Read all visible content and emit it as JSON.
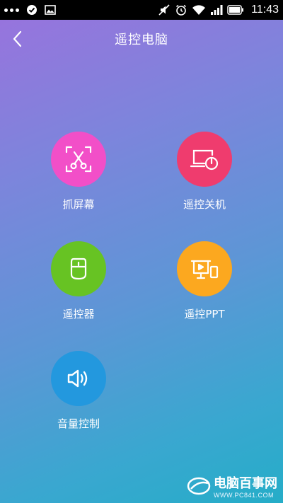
{
  "status_bar": {
    "time": "11:43",
    "icons": [
      "more-dots-icon",
      "check-circle-icon",
      "image-icon",
      "mute-icon",
      "alarm-icon",
      "wifi-icon",
      "signal-icon",
      "battery-icon"
    ]
  },
  "header": {
    "title": "遥控电脑",
    "back_icon": "chevron-left-icon"
  },
  "features": [
    {
      "label": "抓屏幕",
      "color": "#f24fc8",
      "icon": "screenshot-scissors-icon"
    },
    {
      "label": "遥控关机",
      "color": "#ef3c6e",
      "icon": "laptop-power-icon"
    },
    {
      "label": "遥控器",
      "color": "#67c323",
      "icon": "mouse-icon"
    },
    {
      "label": "遥控PPT",
      "color": "#fca81f",
      "icon": "presentation-icon"
    },
    {
      "label": "音量控制",
      "color": "#2398de",
      "icon": "speaker-icon"
    }
  ],
  "watermark": {
    "text": "电脑百事网",
    "url": "WWW.PC841.COM"
  }
}
